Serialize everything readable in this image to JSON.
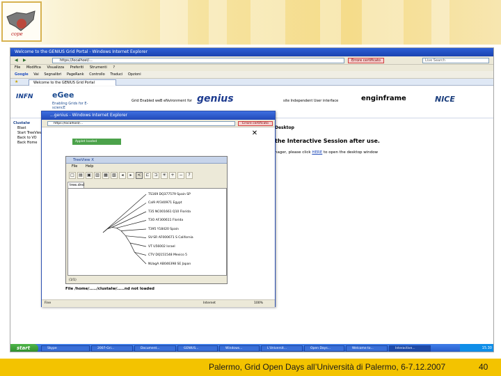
{
  "browser": {
    "title": "Welcome to the GENIUS Grid Portal - Windows Internet Explorer",
    "address": "https://localhost/...",
    "certificate_error": "Errore certificato",
    "search_placeholder": "Live Search",
    "menu": [
      "File",
      "Modifica",
      "Visualizza",
      "Preferiti",
      "Strumenti",
      "?"
    ],
    "toolbar": [
      "Google",
      "Vai",
      "Segnalibri",
      "PageRank",
      "Controllo",
      "Traduci",
      "Opzioni"
    ],
    "tab_label": "Welcome to the GENIUS Grid Portal"
  },
  "portal": {
    "logos": {
      "infn": "INFN",
      "egee": "eGee",
      "egee_tagline": "Enabling Grids for E-sciencE",
      "gerenia": "Grid Enabled weB eNvironment for",
      "genius": "genius",
      "iun": "site Independent User interface",
      "enginframe": "enginframe",
      "nice": "NICE"
    },
    "sidebar": [
      "Clustalw",
      "Blast",
      "Start TreeView",
      "Back to VO",
      "Back Home"
    ],
    "desktop_heading": "Desktop",
    "session_text": "the Interactive Session after use.",
    "manager_prefix": "nager, please click",
    "manager_link": "HERE",
    "manager_suffix": "to open the desktop window"
  },
  "popup": {
    "title": "...genius - Windows Internet Explorer",
    "address": "https://localhost/...",
    "certificate_error": "Errore certificato",
    "applet_status": "Applet loaded",
    "file_message": "File /home/...../clustalw/.....nd not loaded",
    "status_left": "Fine",
    "status_zone": "Internet",
    "status_zoom": "100%"
  },
  "treeview": {
    "title": "TreeView X",
    "menu": [
      "File",
      "Help"
    ],
    "tab_label": "tree.dnd",
    "status": "(1/1)",
    "taxa": [
      "TS169 DQ377579 Spain SP",
      "Cal9 AY340971 Egypt",
      "T35 NC001661 Q10 Florida",
      "T3O AF300611 Florida",
      "T395 Y18420 Spain",
      "SV-SR AF000671 S California",
      "VT U56002 Israel",
      "CTV DQ151548 Mexico 5",
      "NUagA AB046398 SE Japan"
    ]
  },
  "taskbar": {
    "start": "start",
    "items": [
      "Skype",
      "2007-Gri...",
      "Document...",
      "GENIUS...",
      "Windows...",
      "L'Universit...",
      "Open Days...",
      "Welcome to...",
      "Interactive..."
    ],
    "clock": "15.30"
  },
  "slide": {
    "footer": "Palermo, Grid Open Days all’Università di Palermo, 6-7.12.2007",
    "page_number": "40"
  }
}
